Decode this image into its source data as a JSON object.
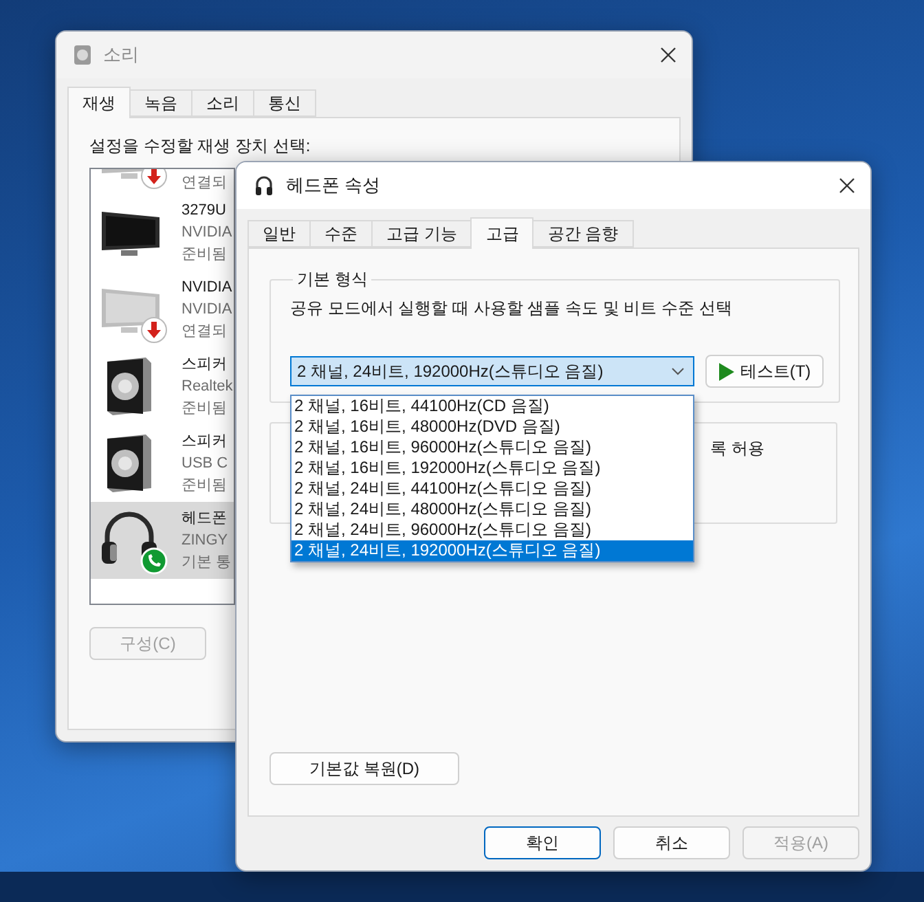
{
  "sound_window": {
    "title": "소리",
    "tabs": [
      {
        "label": "재생",
        "selected": true
      },
      {
        "label": "녹음",
        "selected": false
      },
      {
        "label": "소리",
        "selected": false
      },
      {
        "label": "통신",
        "selected": false
      }
    ],
    "prompt": "설정을 수정할 재생 장치 선택:",
    "devices": [
      {
        "kind": "monitor",
        "disconnected": true,
        "status": "연결되",
        "selected": false
      },
      {
        "kind": "monitor",
        "name": "3279U",
        "detail": "NVIDIA",
        "status": "준비됨",
        "selected": false
      },
      {
        "kind": "monitor",
        "disconnected": true,
        "name": "NVIDIA",
        "detail": "NVIDIA",
        "status": "연결되",
        "selected": false
      },
      {
        "kind": "speaker",
        "name": "스피커",
        "detail": "Realtek",
        "status": "준비됨",
        "selected": false
      },
      {
        "kind": "speaker",
        "name": "스피커",
        "detail": "USB C",
        "status": "준비됨",
        "selected": false
      },
      {
        "kind": "headphones",
        "default_communication": true,
        "name": "헤드폰",
        "detail": "ZINGY",
        "status": "기본 통",
        "selected": true
      }
    ],
    "configure_button": {
      "label": "구성(C)",
      "disabled": true
    }
  },
  "properties_window": {
    "title": "헤드폰 속성",
    "tabs": [
      {
        "label": "일반",
        "selected": false
      },
      {
        "label": "수준",
        "selected": false
      },
      {
        "label": "고급 기능",
        "selected": false
      },
      {
        "label": "고급",
        "selected": true
      },
      {
        "label": "공간 음향",
        "selected": false
      }
    ],
    "default_format": {
      "legend": "기본 형식",
      "description": "공유 모드에서 실행할 때 사용할 샘플 속도 및 비트 수준 선택",
      "value": "2 채널, 24비트, 192000Hz(스튜디오 음질)",
      "expanded": true,
      "options": [
        {
          "label": "2 채널, 16비트, 44100Hz(CD 음질)",
          "selected": false
        },
        {
          "label": "2 채널, 16비트, 48000Hz(DVD 음질)",
          "selected": false
        },
        {
          "label": "2 채널, 16비트, 96000Hz(스튜디오 음질)",
          "selected": false
        },
        {
          "label": "2 채널, 16비트, 192000Hz(스튜디오 음질)",
          "selected": false
        },
        {
          "label": "2 채널, 24비트, 44100Hz(스튜디오 음질)",
          "selected": false
        },
        {
          "label": "2 채널, 24비트, 48000Hz(스튜디오 음질)",
          "selected": false
        },
        {
          "label": "2 채널, 24비트, 96000Hz(스튜디오 음질)",
          "selected": false
        },
        {
          "label": "2 채널, 24비트, 192000Hz(스튜디오 음질)",
          "selected": true
        }
      ],
      "test_button": "테스트(T)"
    },
    "exclusive_mode": {
      "option_text": "록 허용"
    },
    "restore_button": "기본값 복원(D)",
    "buttons": [
      {
        "label": "확인",
        "default": true,
        "disabled": false
      },
      {
        "label": "취소",
        "default": false,
        "disabled": false
      },
      {
        "label": "적용(A)",
        "default": false,
        "disabled": true
      }
    ]
  }
}
